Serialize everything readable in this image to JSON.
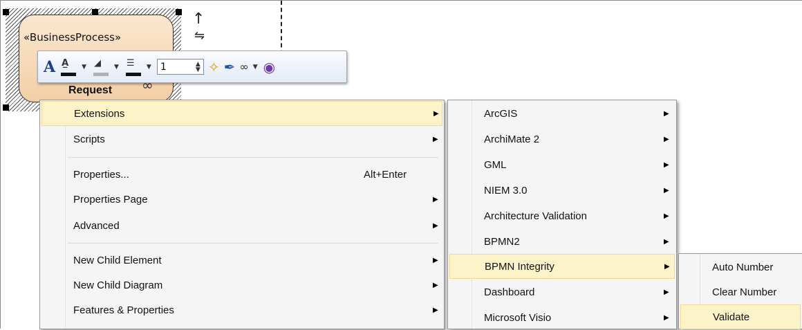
{
  "diagram": {
    "stereotype": "«BusinessProcess»",
    "element_name": "Request"
  },
  "toolbar": {
    "font_icon": "A",
    "line_width_value": "1"
  },
  "context_menu": {
    "items": [
      {
        "label": "Extensions",
        "shortcut": "",
        "submenu": true
      },
      {
        "label": "Scripts",
        "shortcut": "",
        "submenu": true
      },
      {
        "label": "Properties...",
        "shortcut": "Alt+Enter",
        "submenu": false
      },
      {
        "label": "Properties Page",
        "shortcut": "",
        "submenu": true
      },
      {
        "label": "Advanced",
        "shortcut": "",
        "submenu": true
      },
      {
        "label": "New Child Element",
        "shortcut": "",
        "submenu": true
      },
      {
        "label": "New Child Diagram",
        "shortcut": "",
        "submenu": true
      },
      {
        "label": "Features & Properties",
        "shortcut": "",
        "submenu": true
      }
    ]
  },
  "extensions_menu": {
    "items": [
      {
        "label": "ArcGIS"
      },
      {
        "label": "ArchiMate 2"
      },
      {
        "label": "GML"
      },
      {
        "label": "NIEM 3.0"
      },
      {
        "label": "Architecture Validation"
      },
      {
        "label": "BPMN2"
      },
      {
        "label": "BPMN Integrity"
      },
      {
        "label": "Dashboard"
      },
      {
        "label": "Microsoft Visio"
      }
    ]
  },
  "bpmn_integrity_menu": {
    "items": [
      {
        "label": "Auto Number"
      },
      {
        "label": "Clear Number"
      },
      {
        "label": "Validate"
      }
    ]
  },
  "colors": {
    "highlight": "#fdf3c9",
    "element_fill": "#f2cfa6",
    "menu_bg": "#f5f5f5"
  }
}
